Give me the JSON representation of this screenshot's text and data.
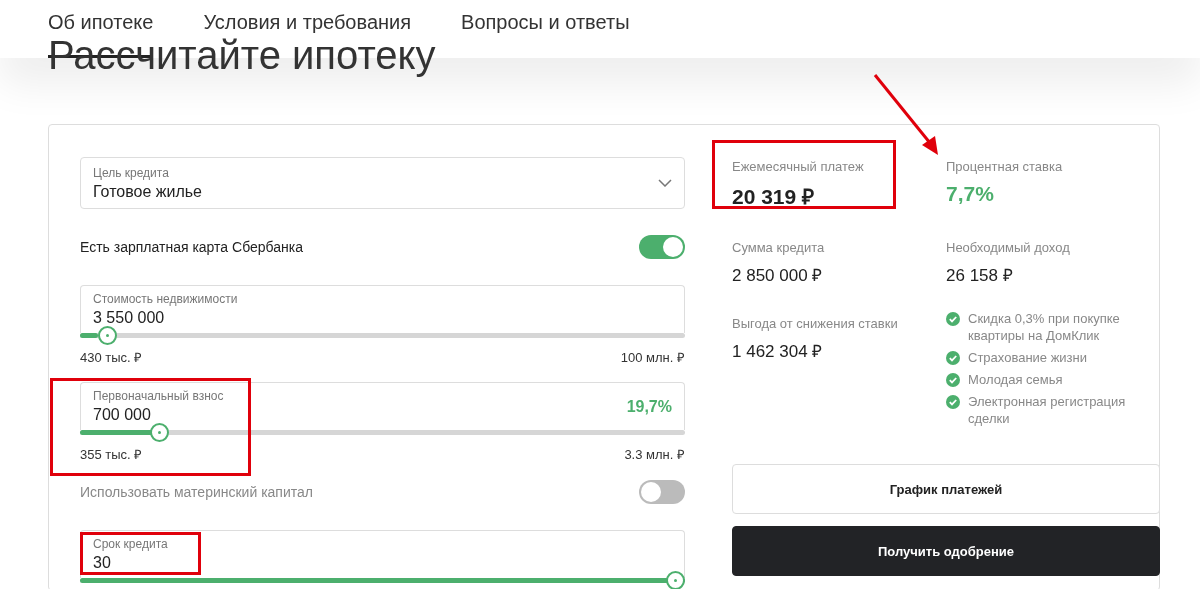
{
  "nav": {
    "tabs": [
      {
        "label": "Об ипотеке",
        "selected": true
      },
      {
        "label": "Условия и требования",
        "selected": false
      },
      {
        "label": "Вопросы и ответы",
        "selected": false
      }
    ]
  },
  "heading": "Рассчитайте ипотеку",
  "form": {
    "rows": [
      {
        "kind": "select",
        "label": "Цель кредита",
        "value": "Готовое жилье",
        "highlighted": false
      },
      {
        "kind": "toggle",
        "label": "Есть зарплатная карта Сбербанка",
        "on": true,
        "disabled": false
      },
      {
        "kind": "slider",
        "label": "Стоимость недвижимости",
        "value": "3 550 000",
        "level": 0.03,
        "min": "430 тыс. ₽",
        "max": "100 млн. ₽",
        "highlighted": false
      },
      {
        "kind": "slider",
        "label": "Первоначальный взнос",
        "value": "700 000",
        "share": "19,7%",
        "level": 0.12,
        "min": "355 тыс. ₽",
        "max": "3.3 млн. ₽",
        "highlighted": true
      },
      {
        "kind": "toggle",
        "label": "Использовать материнский капитал",
        "on": false,
        "disabled": true
      },
      {
        "kind": "slider",
        "label": "Срок кредита",
        "value": "30",
        "level": 1,
        "highlighted": true
      }
    ]
  },
  "results": {
    "metrics": [
      {
        "label": "Ежемесячный платеж",
        "value": "20 319 ₽",
        "prominent": true,
        "accent": false,
        "highlighted": true,
        "pointed": false
      },
      {
        "label": "Процентная ставка",
        "value": "7,7%",
        "prominent": true,
        "accent": true,
        "highlighted": false,
        "pointed": true
      },
      {
        "label": "Сумма кредита",
        "value": "2 850 000 ₽",
        "prominent": false,
        "accent": false,
        "highlighted": false,
        "pointed": false
      },
      {
        "label": "Необходимый доход",
        "value": "26 158 ₽",
        "prominent": false,
        "accent": false,
        "highlighted": false,
        "pointed": false
      },
      {
        "label": "Выгода от снижения ставки",
        "value": "1 462 304 ₽",
        "prominent": false,
        "accent": false,
        "highlighted": false,
        "pointed": false
      }
    ],
    "discounts": [
      "Скидка 0,3% при покупке квартиры на ДомКлик",
      "Страхование жизни",
      "Молодая семья",
      "Электронная регистрация сделки"
    ],
    "buttons": [
      {
        "label": "График платежей",
        "kind": "secondary"
      },
      {
        "label": "Получить одобрение",
        "kind": "primary"
      }
    ]
  }
}
